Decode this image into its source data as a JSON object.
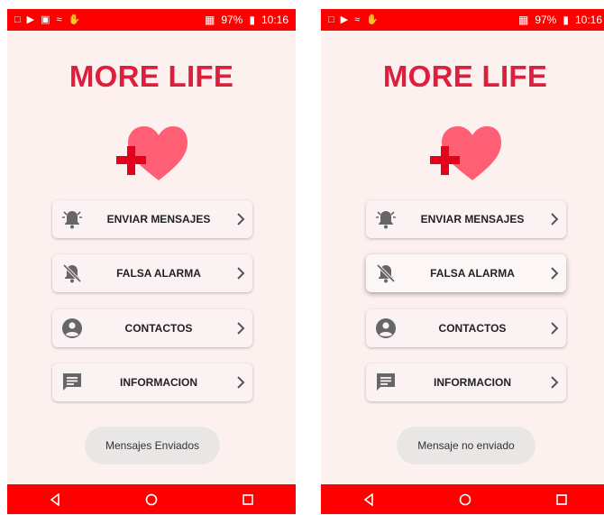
{
  "screens": [
    {
      "status": {
        "battery": "97%",
        "time": "10:16"
      },
      "app_title": "MORE LIFE",
      "menu": [
        {
          "label": "ENVIAR MENSAJES",
          "icon": "bell-ring-icon"
        },
        {
          "label": "FALSA ALARMA",
          "icon": "bell-off-icon"
        },
        {
          "label": "CONTACTOS",
          "icon": "account-circle-icon"
        },
        {
          "label": "INFORMACION",
          "icon": "message-icon"
        }
      ],
      "toast": "Mensajes Enviados"
    },
    {
      "status": {
        "battery": "97%",
        "time": "10:16"
      },
      "app_title": "MORE LIFE",
      "menu": [
        {
          "label": "ENVIAR MENSAJES",
          "icon": "bell-ring-icon"
        },
        {
          "label": "FALSA ALARMA",
          "icon": "bell-off-icon"
        },
        {
          "label": "CONTACTOS",
          "icon": "account-circle-icon"
        },
        {
          "label": "INFORMACION",
          "icon": "message-icon"
        }
      ],
      "toast": "Mensaje no enviado"
    }
  ],
  "colors": {
    "brand_red": "#ff0000",
    "title": "#dd1f3e",
    "heart": "#ff5f74",
    "cross": "#e5001c"
  }
}
